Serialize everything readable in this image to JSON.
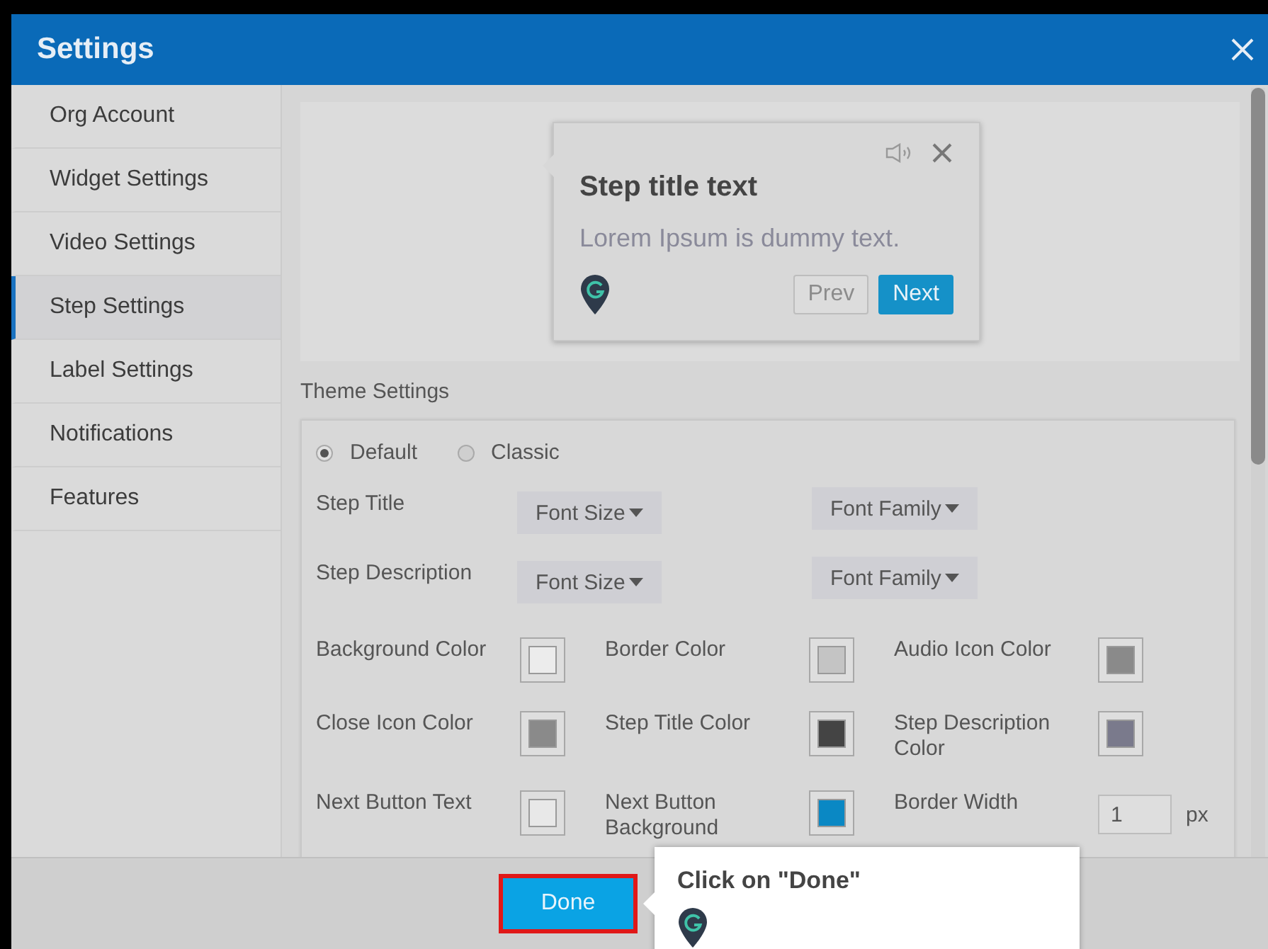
{
  "window": {
    "title": "Settings"
  },
  "sidebar": {
    "items": [
      {
        "label": "Org Account",
        "selected": false
      },
      {
        "label": "Widget Settings",
        "selected": false
      },
      {
        "label": "Video Settings",
        "selected": false
      },
      {
        "label": "Step Settings",
        "selected": true
      },
      {
        "label": "Label Settings",
        "selected": false
      },
      {
        "label": "Notifications",
        "selected": false
      },
      {
        "label": "Features",
        "selected": false
      }
    ]
  },
  "preview": {
    "title": "Step title text",
    "description": "Lorem Ipsum is dummy text.",
    "prev_button": "Prev",
    "next_button": "Next"
  },
  "theme_settings": {
    "heading": "Theme Settings",
    "themes": [
      {
        "label": "Default",
        "selected": true
      },
      {
        "label": "Classic",
        "selected": false
      }
    ],
    "font_rows": [
      {
        "label": "Step Title",
        "size": "Font Size",
        "family": "Font Family"
      },
      {
        "label": "Step Description",
        "size": "Font Size",
        "family": "Font Family"
      }
    ],
    "fields": [
      {
        "kind": "swatch",
        "label": "Background Color",
        "color": "#ececec"
      },
      {
        "kind": "swatch",
        "label": "Border Color",
        "color": "#c4c4c4"
      },
      {
        "kind": "swatch",
        "label": "Audio Icon Color",
        "color": "#8a8a8a"
      },
      {
        "kind": "swatch",
        "label": "Close Icon Color",
        "color": "#8a8a8a"
      },
      {
        "kind": "swatch",
        "label": "Step Title Color",
        "color": "#444444"
      },
      {
        "kind": "swatch",
        "label": "Step Description Color",
        "color": "#7a7a8c"
      },
      {
        "kind": "swatch",
        "label": "Next Button Text",
        "color": "#e8e8e8"
      },
      {
        "kind": "swatch",
        "label": "Next Button Background",
        "color": "#0a88c4"
      }
    ],
    "border_width": {
      "label": "Border Width",
      "value": "1",
      "unit": "px"
    }
  },
  "footer": {
    "done_button": "Done"
  },
  "guide_tooltip": {
    "text": "Click on \"Done\""
  }
}
